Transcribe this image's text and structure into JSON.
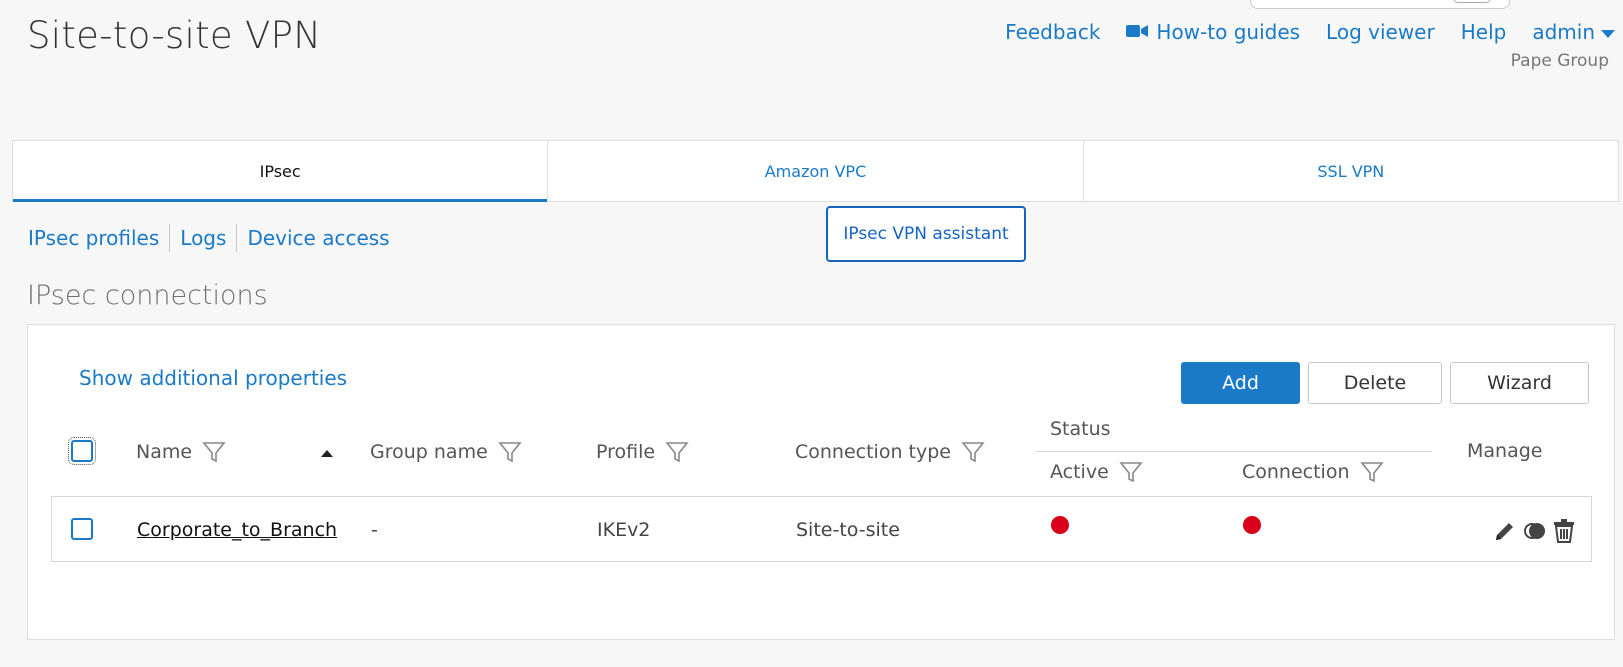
{
  "page": {
    "title": "Site-to-site VPN"
  },
  "topnav": {
    "feedback": "Feedback",
    "howto": "How-to guides",
    "logviewer": "Log viewer",
    "help": "Help",
    "user": "admin",
    "org": "Pape Group"
  },
  "tabs": [
    {
      "label": "IPsec",
      "active": true
    },
    {
      "label": "Amazon VPC",
      "active": false
    },
    {
      "label": "SSL VPN",
      "active": false
    }
  ],
  "subnav": {
    "items": [
      "IPsec profiles",
      "Logs",
      "Device access"
    ]
  },
  "assistant_button": "IPsec VPN assistant",
  "section": {
    "title": "IPsec connections"
  },
  "panel": {
    "show_additional": "Show additional properties",
    "buttons": {
      "add": "Add",
      "delete": "Delete",
      "wizard": "Wizard"
    }
  },
  "table": {
    "headers": {
      "name": "Name",
      "group": "Group name",
      "profile": "Profile",
      "conn_type": "Connection type",
      "status": "Status",
      "active": "Active",
      "connection": "Connection",
      "manage": "Manage"
    },
    "rows": [
      {
        "name": "Corporate_to_Branch",
        "group": "-",
        "profile": "IKEv2",
        "conn_type": "Site-to-site",
        "active_status": "inactive",
        "connection_status": "down"
      }
    ]
  },
  "colors": {
    "accent": "#1a7ac8",
    "status_red": "#d9001b",
    "assistant_border": "#1565c0"
  },
  "icons": [
    "video-camera-icon",
    "caret-down-icon",
    "filter-icon",
    "sort-ascending-icon",
    "edit-pencil-icon",
    "toggle-icon",
    "trash-icon"
  ]
}
